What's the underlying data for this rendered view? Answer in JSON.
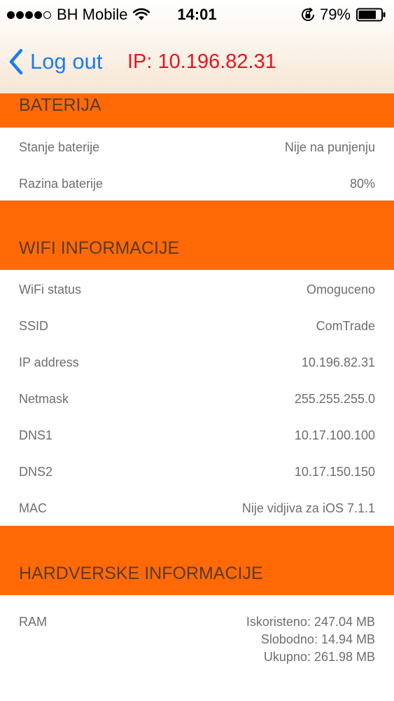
{
  "status_bar": {
    "carrier": "BH Mobile",
    "time": "14:01",
    "battery_percent": "79%",
    "signal_bars": 4,
    "signal_total": 5,
    "battery_level": 0.79
  },
  "nav": {
    "back_label": "Log out",
    "ip_title": "IP: 10.196.82.31"
  },
  "sections": {
    "battery": {
      "title": "BATERIJA",
      "rows": [
        {
          "label": "Stanje baterije",
          "value": "Nije na punjenju"
        },
        {
          "label": "Razina baterije",
          "value": "80%"
        }
      ]
    },
    "wifi": {
      "title": "WIFI INFORMACIJE",
      "rows": [
        {
          "label": "WiFi status",
          "value": "Omoguceno"
        },
        {
          "label": "SSID",
          "value": "ComTrade"
        },
        {
          "label": "IP address",
          "value": "10.196.82.31"
        },
        {
          "label": "Netmask",
          "value": "255.255.255.0"
        },
        {
          "label": "DNS1",
          "value": "10.17.100.100"
        },
        {
          "label": "DNS2",
          "value": "10.17.150.150"
        },
        {
          "label": "MAC",
          "value": "Nije vidjiva za iOS 7.1.1"
        }
      ]
    },
    "hardware": {
      "title": "HARDVERSKE INFORMACIJE",
      "ram": {
        "label": "RAM",
        "used": "Iskoristeno: 247.04 MB",
        "free": "Slobodno: 14.94 MB",
        "total": "Ukupno: 261.98 MB"
      }
    }
  },
  "colors": {
    "section_bg": "#ff6a07",
    "section_text": "#5a3a22",
    "back_blue": "#1a7cf4",
    "ip_red": "#e8141c"
  }
}
